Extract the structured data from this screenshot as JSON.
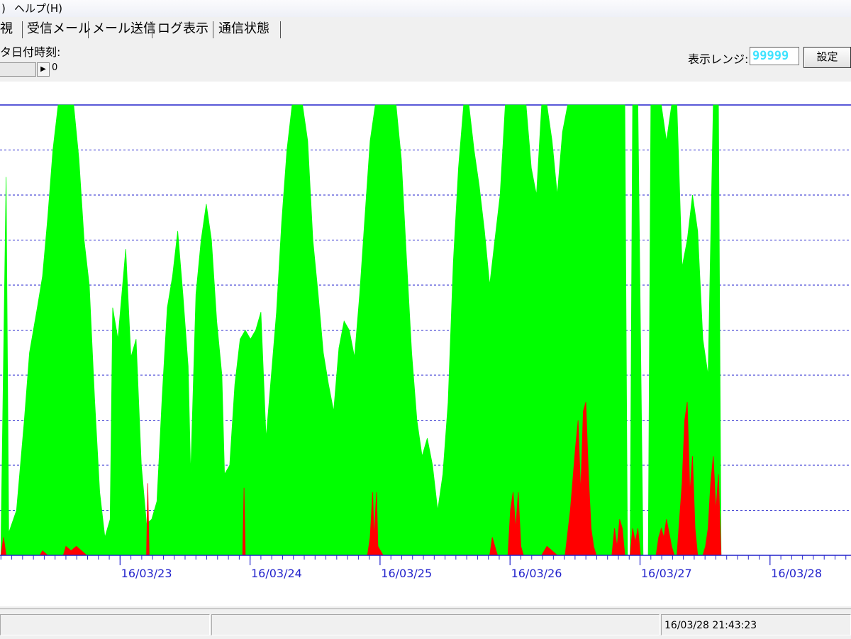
{
  "menubar": {
    "items": [
      ")",
      "ヘルプ(H)"
    ]
  },
  "tabs": [
    {
      "label": "監視"
    },
    {
      "label": "受信メール"
    },
    {
      "label": "メール送信"
    },
    {
      "label": "ログ表示"
    },
    {
      "label": "通信状態"
    }
  ],
  "panel": {
    "timestamp_label": "データ日付時刻:",
    "scroll_value": "0",
    "range_label": "表示レンジ:",
    "range_value": "99999",
    "set_button": "設定"
  },
  "chart_data": {
    "type": "area",
    "x_tick_labels": [
      "16/03/23",
      "16/03/24",
      "16/03/25",
      "16/03/26",
      "16/03/27",
      "16/03/28"
    ],
    "ylim": [
      0,
      99999
    ],
    "grid": true,
    "colors": {
      "series_1": "#00ff00",
      "series_2": "#ff0000",
      "grid": "#2222cc",
      "tick_label": "#2222cc"
    },
    "series": [
      {
        "color": "#00ff00",
        "points": [
          [
            22.0,
            2
          ],
          [
            22.04,
            84
          ],
          [
            22.06,
            5
          ],
          [
            22.12,
            10
          ],
          [
            22.18,
            30
          ],
          [
            22.22,
            45
          ],
          [
            22.28,
            55
          ],
          [
            22.32,
            62
          ],
          [
            22.36,
            75
          ],
          [
            22.4,
            90
          ],
          [
            22.44,
            100
          ],
          [
            22.5,
            100
          ],
          [
            22.56,
            100
          ],
          [
            22.6,
            88
          ],
          [
            22.64,
            70
          ],
          [
            22.68,
            60
          ],
          [
            22.72,
            35
          ],
          [
            22.76,
            14
          ],
          [
            22.8,
            4
          ],
          [
            22.84,
            8
          ],
          [
            22.86,
            55
          ],
          [
            22.9,
            48
          ],
          [
            22.96,
            68
          ],
          [
            23.0,
            44
          ],
          [
            23.04,
            48
          ],
          [
            23.08,
            20
          ],
          [
            23.12,
            7
          ],
          [
            23.16,
            8
          ],
          [
            23.2,
            12
          ],
          [
            23.24,
            35
          ],
          [
            23.28,
            55
          ],
          [
            23.32,
            62
          ],
          [
            23.36,
            72
          ],
          [
            23.4,
            58
          ],
          [
            23.44,
            42
          ],
          [
            23.46,
            18
          ],
          [
            23.5,
            58
          ],
          [
            23.54,
            70
          ],
          [
            23.58,
            78
          ],
          [
            23.62,
            70
          ],
          [
            23.66,
            52
          ],
          [
            23.7,
            40
          ],
          [
            23.72,
            18
          ],
          [
            23.76,
            20
          ],
          [
            23.8,
            38
          ],
          [
            23.84,
            48
          ],
          [
            23.88,
            50
          ],
          [
            23.92,
            48
          ],
          [
            23.96,
            50
          ],
          [
            24.0,
            54
          ],
          [
            24.04,
            26
          ],
          [
            24.08,
            40
          ],
          [
            24.12,
            54
          ],
          [
            24.16,
            74
          ],
          [
            24.2,
            90
          ],
          [
            24.24,
            100
          ],
          [
            24.28,
            100
          ],
          [
            24.32,
            100
          ],
          [
            24.36,
            92
          ],
          [
            24.4,
            70
          ],
          [
            24.44,
            58
          ],
          [
            24.48,
            45
          ],
          [
            24.52,
            38
          ],
          [
            24.56,
            32
          ],
          [
            24.6,
            46
          ],
          [
            24.64,
            52
          ],
          [
            24.68,
            50
          ],
          [
            24.72,
            44
          ],
          [
            24.76,
            58
          ],
          [
            24.8,
            75
          ],
          [
            24.84,
            92
          ],
          [
            24.88,
            100
          ],
          [
            24.92,
            100
          ],
          [
            24.96,
            100
          ],
          [
            25.0,
            100
          ],
          [
            25.04,
            100
          ],
          [
            25.08,
            88
          ],
          [
            25.12,
            66
          ],
          [
            25.16,
            45
          ],
          [
            25.2,
            30
          ],
          [
            25.24,
            22
          ],
          [
            25.28,
            26
          ],
          [
            25.32,
            20
          ],
          [
            25.36,
            10
          ],
          [
            25.4,
            18
          ],
          [
            25.44,
            34
          ],
          [
            25.48,
            65
          ],
          [
            25.52,
            86
          ],
          [
            25.56,
            100
          ],
          [
            25.6,
            100
          ],
          [
            25.64,
            90
          ],
          [
            25.68,
            82
          ],
          [
            25.72,
            72
          ],
          [
            25.76,
            60
          ],
          [
            25.8,
            70
          ],
          [
            25.84,
            80
          ],
          [
            25.88,
            100
          ],
          [
            25.92,
            100
          ],
          [
            25.96,
            100
          ],
          [
            26.0,
            100
          ],
          [
            26.04,
            100
          ],
          [
            26.08,
            86
          ],
          [
            26.12,
            80
          ],
          [
            26.16,
            100
          ],
          [
            26.2,
            100
          ],
          [
            26.24,
            92
          ],
          [
            26.28,
            80
          ],
          [
            26.32,
            94
          ],
          [
            26.36,
            100
          ],
          [
            26.4,
            100
          ],
          [
            26.44,
            100
          ],
          [
            26.48,
            100
          ],
          [
            26.52,
            100
          ],
          [
            26.56,
            100
          ],
          [
            26.6,
            100
          ],
          [
            26.64,
            100
          ],
          [
            26.68,
            100
          ],
          [
            26.72,
            100
          ],
          [
            26.76,
            100
          ],
          [
            26.8,
            100
          ],
          [
            26.82,
            0
          ],
          [
            26.84,
            0
          ],
          [
            26.86,
            100
          ],
          [
            26.9,
            100
          ],
          [
            26.94,
            0
          ],
          [
            26.98,
            0
          ],
          [
            27.0,
            100
          ],
          [
            27.04,
            100
          ],
          [
            27.08,
            100
          ],
          [
            27.12,
            92
          ],
          [
            27.16,
            100
          ],
          [
            27.2,
            100
          ],
          [
            27.24,
            64
          ],
          [
            27.28,
            70
          ],
          [
            27.32,
            80
          ],
          [
            27.36,
            72
          ],
          [
            27.4,
            48
          ],
          [
            27.44,
            40
          ],
          [
            27.48,
            100
          ],
          [
            27.52,
            100
          ],
          [
            27.54,
            0
          ]
        ]
      },
      {
        "color": "#ff0000",
        "points": [
          [
            22.0,
            0
          ],
          [
            22.02,
            4
          ],
          [
            22.04,
            0
          ],
          [
            22.3,
            0
          ],
          [
            22.32,
            1
          ],
          [
            22.36,
            0
          ],
          [
            22.48,
            0
          ],
          [
            22.5,
            2
          ],
          [
            22.54,
            1
          ],
          [
            22.58,
            2
          ],
          [
            22.62,
            1
          ],
          [
            22.66,
            0
          ],
          [
            23.12,
            0
          ],
          [
            23.13,
            16
          ],
          [
            23.14,
            0
          ],
          [
            23.86,
            0
          ],
          [
            23.87,
            15
          ],
          [
            23.88,
            0
          ],
          [
            24.82,
            0
          ],
          [
            24.84,
            4
          ],
          [
            24.86,
            14
          ],
          [
            24.87,
            4
          ],
          [
            24.89,
            14
          ],
          [
            24.9,
            2
          ],
          [
            24.94,
            0
          ],
          [
            25.76,
            0
          ],
          [
            25.78,
            4
          ],
          [
            25.8,
            2
          ],
          [
            25.82,
            0
          ],
          [
            25.9,
            0
          ],
          [
            25.92,
            10
          ],
          [
            25.94,
            14
          ],
          [
            25.96,
            6
          ],
          [
            25.98,
            14
          ],
          [
            26.0,
            2
          ],
          [
            26.02,
            0
          ],
          [
            26.16,
            0
          ],
          [
            26.2,
            2
          ],
          [
            26.24,
            1
          ],
          [
            26.28,
            0
          ],
          [
            26.34,
            0
          ],
          [
            26.38,
            10
          ],
          [
            26.42,
            24
          ],
          [
            26.44,
            30
          ],
          [
            26.46,
            14
          ],
          [
            26.48,
            32
          ],
          [
            26.5,
            34
          ],
          [
            26.52,
            18
          ],
          [
            26.54,
            6
          ],
          [
            26.56,
            2
          ],
          [
            26.58,
            0
          ],
          [
            26.7,
            0
          ],
          [
            26.72,
            6
          ],
          [
            26.74,
            2
          ],
          [
            26.76,
            8
          ],
          [
            26.78,
            6
          ],
          [
            26.8,
            0
          ],
          [
            26.84,
            0
          ],
          [
            26.86,
            6
          ],
          [
            26.88,
            3
          ],
          [
            26.9,
            6
          ],
          [
            26.92,
            0
          ],
          [
            27.04,
            0
          ],
          [
            27.06,
            4
          ],
          [
            27.08,
            6
          ],
          [
            27.1,
            4
          ],
          [
            27.12,
            8
          ],
          [
            27.16,
            2
          ],
          [
            27.18,
            0
          ],
          [
            27.2,
            0
          ],
          [
            27.24,
            16
          ],
          [
            27.26,
            30
          ],
          [
            27.28,
            34
          ],
          [
            27.3,
            14
          ],
          [
            27.32,
            22
          ],
          [
            27.34,
            6
          ],
          [
            27.36,
            0
          ],
          [
            27.4,
            0
          ],
          [
            27.42,
            2
          ],
          [
            27.44,
            6
          ],
          [
            27.46,
            16
          ],
          [
            27.48,
            22
          ],
          [
            27.5,
            10
          ],
          [
            27.52,
            18
          ],
          [
            27.54,
            0
          ]
        ]
      }
    ]
  },
  "statusbar": {
    "time": "16/03/28 21:43:23"
  }
}
